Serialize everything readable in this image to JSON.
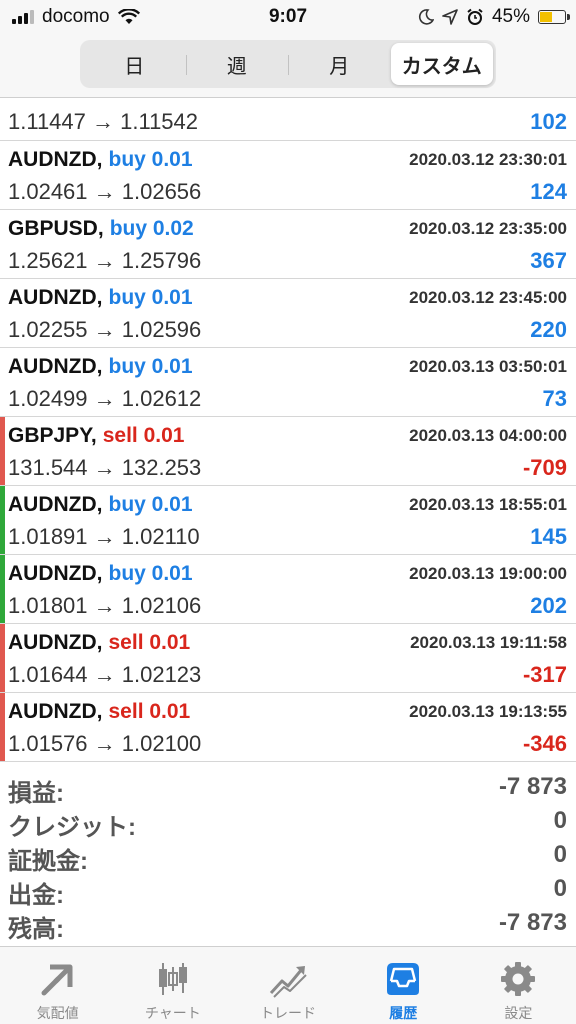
{
  "status_bar": {
    "carrier": "docomo",
    "time": "9:07",
    "battery": "45%"
  },
  "tabs": {
    "labels": [
      "日",
      "週",
      "月",
      "カスタム"
    ],
    "selected": "カスタム"
  },
  "partial_row": {
    "prices": "1.11447 → 1.11542",
    "profit": "102"
  },
  "trades": [
    {
      "symbol": "AUDNZD,",
      "action": "buy 0.01",
      "side": "buy",
      "time": "2020.03.12 23:30:01",
      "prices": "1.02461 → 1.02656",
      "profit": "124",
      "marker": "none"
    },
    {
      "symbol": "GBPUSD,",
      "action": "buy 0.02",
      "side": "buy",
      "time": "2020.03.12 23:35:00",
      "prices": "1.25621 → 1.25796",
      "profit": "367",
      "marker": "none"
    },
    {
      "symbol": "AUDNZD,",
      "action": "buy 0.01",
      "side": "buy",
      "time": "2020.03.12 23:45:00",
      "prices": "1.02255 → 1.02596",
      "profit": "220",
      "marker": "none"
    },
    {
      "symbol": "AUDNZD,",
      "action": "buy 0.01",
      "side": "buy",
      "time": "2020.03.13 03:50:01",
      "prices": "1.02499 → 1.02612",
      "profit": "73",
      "marker": "none"
    },
    {
      "symbol": "GBPJPY,",
      "action": "sell 0.01",
      "side": "sell",
      "time": "2020.03.13 04:00:00",
      "prices": "131.544 → 132.253",
      "profit": "-709",
      "marker": "red"
    },
    {
      "symbol": "AUDNZD,",
      "action": "buy 0.01",
      "side": "buy",
      "time": "2020.03.13 18:55:01",
      "prices": "1.01891 → 1.02110",
      "profit": "145",
      "marker": "green"
    },
    {
      "symbol": "AUDNZD,",
      "action": "buy 0.01",
      "side": "buy",
      "time": "2020.03.13 19:00:00",
      "prices": "1.01801 → 1.02106",
      "profit": "202",
      "marker": "green"
    },
    {
      "symbol": "AUDNZD,",
      "action": "sell 0.01",
      "side": "sell",
      "time": "2020.03.13 19:11:58",
      "prices": "1.01644 → 1.02123",
      "profit": "-317",
      "marker": "red"
    },
    {
      "symbol": "AUDNZD,",
      "action": "sell 0.01",
      "side": "sell",
      "time": "2020.03.13 19:13:55",
      "prices": "1.01576 → 1.02100",
      "profit": "-346",
      "marker": "red"
    }
  ],
  "summary": [
    {
      "label": "損益:",
      "value": "-7 873"
    },
    {
      "label": "クレジット:",
      "value": "0"
    },
    {
      "label": "証拠金:",
      "value": "0"
    },
    {
      "label": "出金:",
      "value": "0"
    },
    {
      "label": "残高:",
      "value": "-7 873"
    }
  ],
  "tabbar": {
    "items": [
      {
        "label": "気配値",
        "icon": "quotes-icon"
      },
      {
        "label": "チャート",
        "icon": "chart-icon"
      },
      {
        "label": "トレード",
        "icon": "trade-icon"
      },
      {
        "label": "履歴",
        "icon": "history-icon"
      },
      {
        "label": "設定",
        "icon": "settings-icon"
      }
    ],
    "active": "履歴"
  },
  "colors": {
    "buy": "#1e7fe3",
    "sell": "#d9261c",
    "marker_red": "#e0584f",
    "marker_green": "#2fa83a",
    "accent": "#1e7fe3"
  }
}
